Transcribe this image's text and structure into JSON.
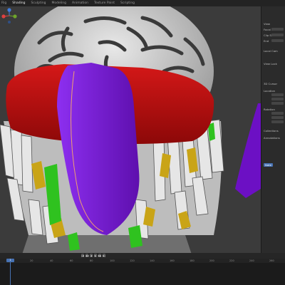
{
  "menu": {
    "tabs": [
      "Rig",
      "Shading",
      "Sculpting",
      "Modeling",
      "Animation",
      "Texture Paint",
      "Scripting"
    ],
    "active_tab": 1
  },
  "scene": {
    "colors": {
      "skin": "#d9d9d9",
      "band": "#cc1111",
      "purple": "#7a16d4",
      "hair_yellow": "#c9a417",
      "hair_green": "#2fc21f",
      "background": "#3b3b3b"
    }
  },
  "gizmo": {
    "axis_colors": {
      "x": "#e0413f",
      "y": "#6ea52a",
      "z": "#3f7de0"
    }
  },
  "properties_panel": {
    "labels": [
      "View",
      "Focal Len",
      "Clip Start",
      "End",
      "Local Cam",
      "View Lock",
      "3D Cursor",
      "Location",
      "Rotation",
      "Collections",
      "Annotations",
      "Note"
    ]
  },
  "transport": {
    "buttons": [
      "|◀",
      "◀◀",
      "◀",
      "▶",
      "▶▶",
      "▶|"
    ]
  },
  "timeline": {
    "ticks": [
      "0",
      "20",
      "40",
      "60",
      "80",
      "100",
      "120",
      "140",
      "160",
      "180",
      "200",
      "220",
      "240",
      "260"
    ],
    "current_frame": "1"
  }
}
